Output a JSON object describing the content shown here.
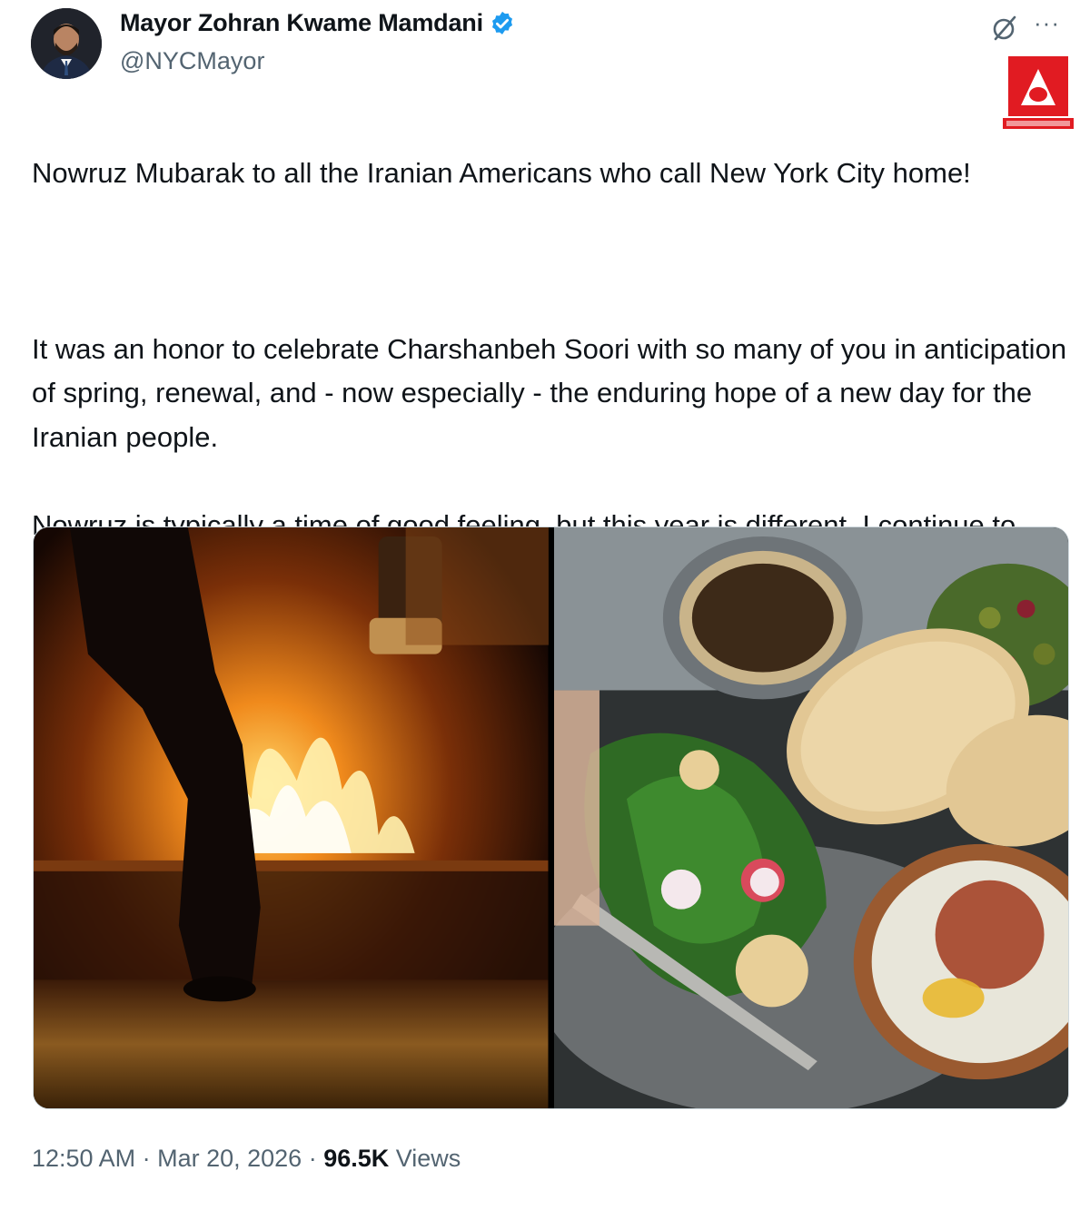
{
  "author": {
    "display_name": "Mayor Zohran Kwame Mamdani",
    "handle": "@NYCMayor",
    "verified": true,
    "verified_color": "#1d9bf0"
  },
  "header_icons": [
    "grok-icon",
    "more-icon"
  ],
  "more_glyph": "···",
  "watermark_color": "#e11b22",
  "tweet": {
    "paragraphs": [
      "Nowruz Mubarak to all the Iranian Americans who call New York City home!",
      "",
      "It was an honor to celebrate Charshanbeh Soori with so many of you in anticipation of spring, renewal, and - now especially - the enduring hope of a new day for the Iranian people.",
      " Nowruz is typically a time of good feeling, but this year is different. I continue to stand in opposition to this war, and I wish as many moments of joy as possible for all Iranians observing this special holiday."
    ]
  },
  "media": [
    {
      "name": "bonfire-photo",
      "subject": "person jumping over fire"
    },
    {
      "name": "food-photo",
      "subject": "Nowruz spread with bread, herbs and dips"
    }
  ],
  "meta": {
    "time": "12:50 AM",
    "separator": " · ",
    "date": "Mar 20, 2026",
    "views_count": "96.5K",
    "views_label": " Views"
  }
}
